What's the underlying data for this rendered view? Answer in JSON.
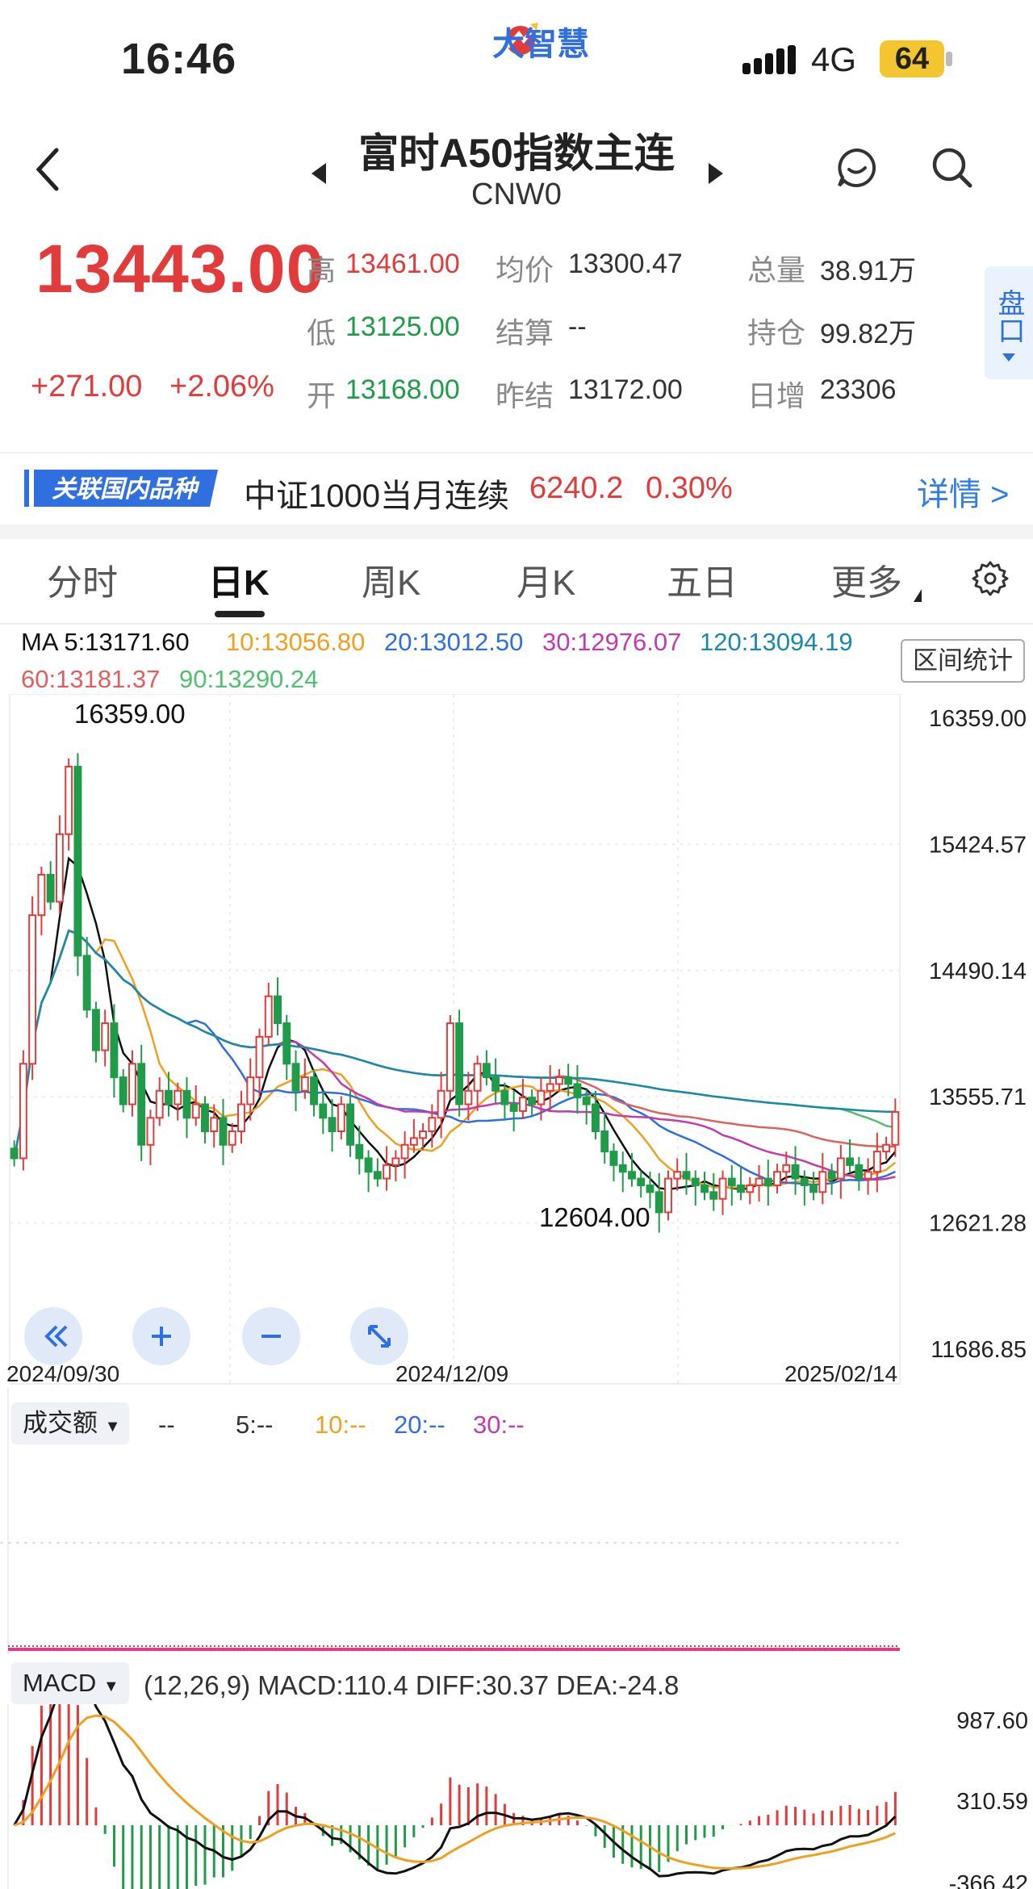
{
  "status_bar": {
    "time": "16:46",
    "app_brand": "大智慧",
    "network": "4G",
    "battery": "64"
  },
  "header": {
    "title": "富时A50指数主连",
    "code": "CNW0"
  },
  "quote": {
    "price": "13443.00",
    "change": "+271.00",
    "change_pct": "+2.06%",
    "rows": [
      [
        {
          "label": "高",
          "value": "13461.00",
          "tone": "red"
        },
        {
          "label": "均价",
          "value": "13300.47",
          "tone": "dark"
        },
        {
          "label": "总量",
          "value": "38.91万",
          "tone": "dark"
        }
      ],
      [
        {
          "label": "低",
          "value": "13125.00",
          "tone": "green"
        },
        {
          "label": "结算",
          "value": "--",
          "tone": "dark"
        },
        {
          "label": "持仓",
          "value": "99.82万",
          "tone": "dark"
        }
      ],
      [
        {
          "label": "开",
          "value": "13168.00",
          "tone": "green"
        },
        {
          "label": "昨结",
          "value": "13172.00",
          "tone": "dark"
        },
        {
          "label": "日增",
          "value": "23306",
          "tone": "dark"
        }
      ]
    ],
    "side_button": "盘口"
  },
  "related": {
    "tag": "关联国内品种",
    "name": "中证1000当月连续",
    "price": "6240.2",
    "pct": "0.30%",
    "detail": "详情 >"
  },
  "tabs": [
    "分时",
    "日K",
    "周K",
    "月K",
    "五日",
    "更多"
  ],
  "active_tab": "日K",
  "ma_legend": {
    "ma5": "MA 5:13171.60",
    "ma10": "10:13056.80",
    "ma20": "20:13012.50",
    "ma30": "30:12976.07",
    "ma120": "120:13094.19",
    "ma60": "60:13181.37",
    "ma90": "90:13290.24",
    "range_button": "区间统计"
  },
  "colors": {
    "up": "#e23b3b",
    "down": "#1f9b4a",
    "ma5": "#111111",
    "ma10": "#f0a020",
    "ma20": "#2f6fe0",
    "ma30": "#c23bb0",
    "ma60": "#e06060",
    "ma90": "#50c070",
    "ma120": "#1a8aa8"
  },
  "chart_data": {
    "type": "candlestick",
    "y_ticks": [
      "16359.00",
      "15424.57",
      "14490.14",
      "13555.71",
      "12621.28",
      "11686.85"
    ],
    "ylim": [
      11686.85,
      16359.0
    ],
    "x_ticks": [
      "2024/09/30",
      "2024/12/09",
      "2025/02/14"
    ],
    "max_label": "16359.00",
    "min_label": "12604.00",
    "closes": [
      13100,
      13800,
      14900,
      15200,
      15000,
      15500,
      16000,
      14600,
      14200,
      13900,
      14100,
      13700,
      13500,
      13800,
      13200,
      13400,
      13600,
      13500,
      13600,
      13400,
      13500,
      13300,
      13400,
      13200,
      13300,
      13500,
      13700,
      14000,
      14300,
      14100,
      13800,
      13600,
      13700,
      13500,
      13400,
      13300,
      13500,
      13200,
      13100,
      13000,
      12950,
      13050,
      13100,
      13200,
      13250,
      13300,
      13400,
      13600,
      14100,
      13500,
      13600,
      13800,
      13700,
      13600,
      13500,
      13450,
      13550,
      13500,
      13600,
      13650,
      13700,
      13650,
      13550,
      13500,
      13300,
      13150,
      13050,
      13000,
      12950,
      12900,
      12850,
      12700,
      12950,
      13000,
      12950,
      12900,
      12850,
      12800,
      12950,
      12900,
      12850,
      12900,
      12950,
      12900,
      13000,
      13050,
      12950,
      12900,
      12850,
      13000,
      12950,
      13100,
      13050,
      12950,
      13000,
      13150,
      13200,
      13443
    ],
    "volume_legend": {
      "base": "--",
      "v5": "5:--",
      "v10": "10:--",
      "v20": "20:--",
      "v30": "30:--"
    },
    "macd": {
      "params": "(12,26,9) MACD:110.4 DIFF:30.37 DEA:-24.8",
      "y_ticks": [
        "987.60",
        "310.59",
        "-366.42"
      ]
    }
  },
  "panels": {
    "volume_button": "成交额",
    "macd_button": "MACD"
  }
}
